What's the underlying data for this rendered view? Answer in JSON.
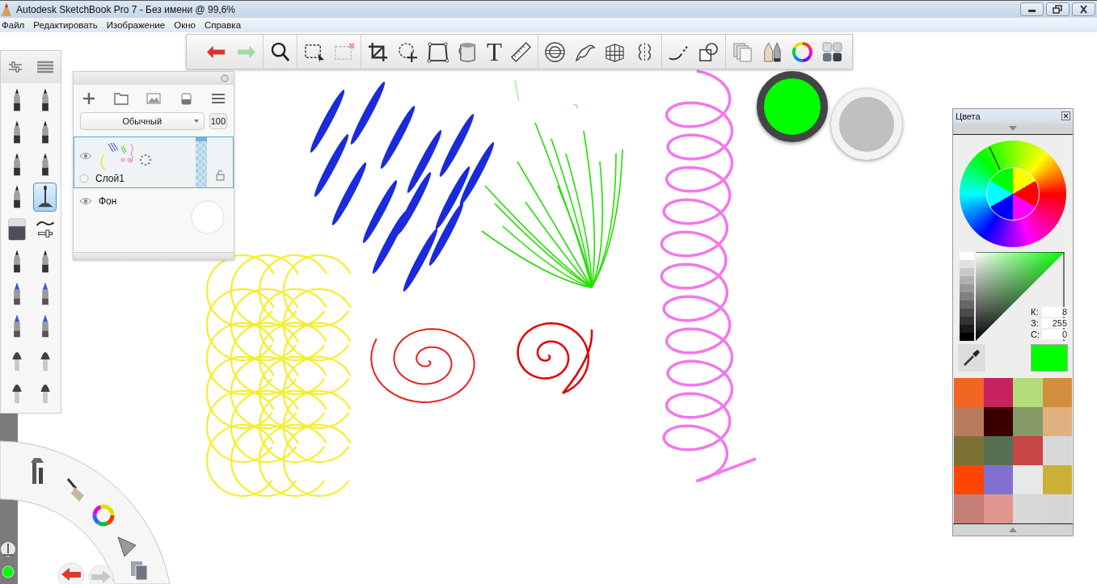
{
  "window": {
    "title": "Autodesk SketchBook Pro 7 - Без имени @ 99,6%"
  },
  "menu": [
    "Файл",
    "Редактировать",
    "Изображение",
    "Окно",
    "Справка"
  ],
  "toolbar": {
    "text_tool": "T"
  },
  "brushes": [
    {
      "kind": "pen",
      "selected": false
    },
    {
      "kind": "pen",
      "selected": false
    },
    {
      "kind": "pen",
      "selected": false
    },
    {
      "kind": "pen",
      "selected": false
    },
    {
      "kind": "pen",
      "selected": false
    },
    {
      "kind": "pen",
      "selected": false
    },
    {
      "kind": "pen",
      "selected": false
    },
    {
      "kind": "airbrush",
      "selected": true
    },
    {
      "kind": "eraser",
      "selected": false
    },
    {
      "kind": "smudge",
      "selected": false
    },
    {
      "kind": "pen",
      "selected": false
    },
    {
      "kind": "pen",
      "selected": false
    },
    {
      "kind": "marker",
      "selected": false
    },
    {
      "kind": "marker",
      "selected": false
    },
    {
      "kind": "marker",
      "selected": false
    },
    {
      "kind": "marker",
      "selected": false
    },
    {
      "kind": "brush",
      "selected": false
    },
    {
      "kind": "brush",
      "selected": false
    },
    {
      "kind": "brush",
      "selected": false
    },
    {
      "kind": "brush",
      "selected": false
    }
  ],
  "layers_panel": {
    "blend_mode": "Обычный",
    "opacity": "100",
    "layers": [
      {
        "name": "Слой1",
        "selected": true,
        "visible": true,
        "level": 1
      },
      {
        "name": "Фон",
        "selected": false,
        "visible": true
      }
    ]
  },
  "pucks": [
    {
      "color": "#00ff00"
    },
    {
      "color": "#c0c0c0"
    }
  ],
  "colors_panel": {
    "title": "Цвета",
    "current": {
      "color": "#00ff00"
    },
    "fields": [
      {
        "label": "К:",
        "value": "8"
      },
      {
        "label": "З:",
        "value": "255"
      },
      {
        "label": "С:",
        "value": "0"
      }
    ],
    "swatches": [
      {
        "color": "#f26522"
      },
      {
        "color": "#c8215f"
      },
      {
        "color": "#b3dd7a"
      },
      {
        "color": "#d28e3e"
      },
      {
        "color": "#b87b5e"
      },
      {
        "color": "#3a0000"
      },
      {
        "color": "#859a66"
      },
      {
        "color": "#e0b07e"
      },
      {
        "color": "#7b7133"
      },
      {
        "color": "#557050"
      },
      {
        "color": "#c84545"
      },
      {
        "color": "#d8d8d8"
      },
      {
        "color": "#ff4500"
      },
      {
        "color": "#8270d0"
      },
      {
        "color": "#e8e8e8"
      },
      {
        "color": "#cbb036"
      },
      {
        "color": "#c47f76"
      },
      {
        "color": "#e0968e"
      },
      {
        "color": "#d8d8d8"
      },
      {
        "color": "#d6d6d6"
      }
    ]
  }
}
